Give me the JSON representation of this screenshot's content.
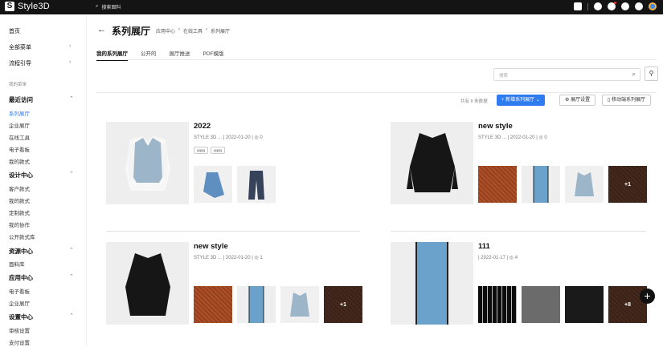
{
  "topbar": {
    "brand": "Style3D",
    "search_placeholder": "搜索面料"
  },
  "sidebar": {
    "home": "首页",
    "all_menu": "全部菜单",
    "guide": "流程引导",
    "my_menu": "我的菜单",
    "groups": [
      {
        "title": "最近访问",
        "items": [
          "系列展厅",
          "企业展厅",
          "在线工具",
          "电子看板",
          "我的款式"
        ]
      },
      {
        "title": "设计中心",
        "items": [
          "客户款式",
          "我的款式",
          "定制款式",
          "我的协作",
          "公开款式库"
        ]
      },
      {
        "title": "资源中心",
        "items": [
          "面料库"
        ]
      },
      {
        "title": "应用中心",
        "items": [
          "电子看板",
          "企业展厅"
        ]
      },
      {
        "title": "设置中心",
        "items": [
          "审核设置",
          "支付设置"
        ]
      }
    ]
  },
  "header": {
    "title": "系列展厅",
    "breadcrumb": [
      "应用中心",
      "在线工具",
      "系列展厅"
    ]
  },
  "tabs": [
    "我的系列展厅",
    "公开的",
    "展厅推送",
    "PDF模版"
  ],
  "search": {
    "placeholder": "搜索"
  },
  "toolbar": {
    "count": "共有 8 条数据",
    "new": "+ 新增系列展厅",
    "settings": "展厅设置",
    "mobile": "移动端系列展厅"
  },
  "cards": [
    {
      "title": "2022",
      "meta": "STYLE 3D ... | 2022-01-20 | ◎ 0",
      "tags": [
        "qqqq",
        "qqqq"
      ],
      "thumbs": [
        "skirt",
        "jeans"
      ],
      "more": ""
    },
    {
      "title": "new style",
      "meta": "STYLE 3D ... | 2022-01-20 | ◎ 0",
      "tags": [],
      "thumbs": [
        "rust",
        "blue",
        "vest",
        "brown"
      ],
      "more": "+1"
    },
    {
      "title": "new style",
      "meta": "STYLE 3D ... | 2022-01-20 | ◎ 1",
      "tags": [],
      "thumbs": [
        "rust",
        "blue",
        "vest",
        "brown"
      ],
      "more": "+1"
    },
    {
      "title": "111",
      "meta": "| 2022-01-17 | ◎ 4",
      "tags": [],
      "thumbs": [
        "pin",
        "grey",
        "dk",
        "brown"
      ],
      "more": "+8"
    }
  ],
  "colors": {
    "accent": "#2f7bf0",
    "topbar": "#141414"
  }
}
